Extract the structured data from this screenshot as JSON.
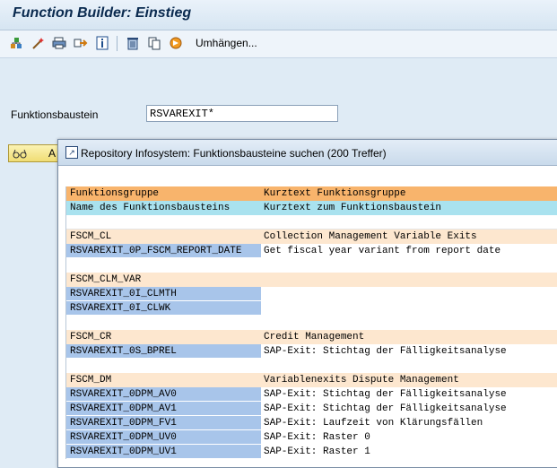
{
  "window": {
    "title": "Function Builder: Einstieg"
  },
  "toolbar": {
    "icons": [
      "hierarchy-icon",
      "magic-wand-icon",
      "printer-icon",
      "transfer-icon",
      "info-icon",
      "trash-icon",
      "copy-icon",
      "rename-icon"
    ],
    "reassign_label": "Umhängen..."
  },
  "form": {
    "label": "Funktionsbaustein",
    "value": "RSVAREXIT*"
  },
  "button": {
    "label": "A"
  },
  "dialog": {
    "title": "Repository Infosystem: Funktionsbausteine suchen (200 Treffer)",
    "header1": {
      "c1": "Funktionsgruppe",
      "c2": "Kurztext Funktionsgruppe"
    },
    "header2": {
      "c1": "Name des Funktionsbausteins",
      "c2": "Kurztext zum Funktionsbaustein"
    },
    "groups": [
      {
        "name": "FSCM_CL",
        "text": "Collection Management Variable Exits",
        "items": [
          {
            "name": "RSVAREXIT_0P_FSCM_REPORT_DATE",
            "text": "Get fiscal year variant from report date"
          }
        ]
      },
      {
        "name": "FSCM_CLM_VAR",
        "text": "",
        "items": [
          {
            "name": "RSVAREXIT_0I_CLMTH",
            "text": ""
          },
          {
            "name": "RSVAREXIT_0I_CLWK",
            "text": ""
          }
        ]
      },
      {
        "name": "FSCM_CR",
        "text": "Credit Management",
        "items": [
          {
            "name": "RSVAREXIT_0S_BPREL",
            "text": "SAP-Exit: Stichtag der Fälligkeitsanalyse"
          }
        ]
      },
      {
        "name": "FSCM_DM",
        "text": "Variablenexits Dispute Management",
        "items": [
          {
            "name": "RSVAREXIT_0DPM_AV0",
            "text": "SAP-Exit: Stichtag der Fälligkeitsanalyse"
          },
          {
            "name": "RSVAREXIT_0DPM_AV1",
            "text": "SAP-Exit: Stichtag der Fälligkeitsanalyse"
          },
          {
            "name": "RSVAREXIT_0DPM_FV1",
            "text": "SAP-Exit: Laufzeit von Klärungsfällen"
          },
          {
            "name": "RSVAREXIT_0DPM_UV0",
            "text": "SAP-Exit: Raster 0"
          },
          {
            "name": "RSVAREXIT_0DPM_UV1",
            "text": "SAP-Exit: Raster 1"
          }
        ]
      }
    ]
  }
}
